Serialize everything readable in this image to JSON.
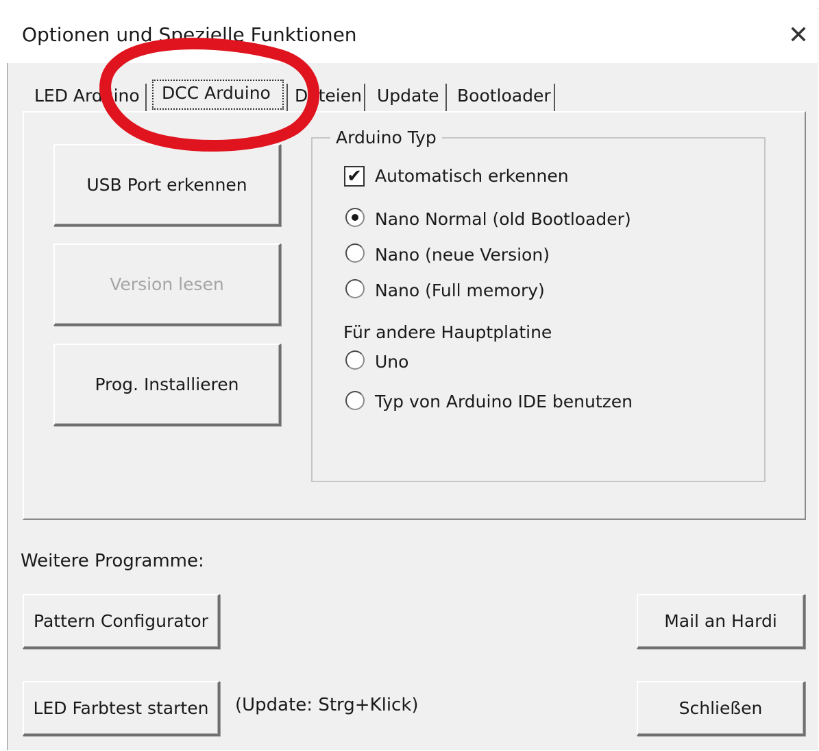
{
  "window": {
    "title": "Optionen und Spezielle Funktionen",
    "close_glyph": "✕"
  },
  "tabs": [
    {
      "label": "LED Arduino"
    },
    {
      "label": "DCC Arduino",
      "selected": true
    },
    {
      "label": "Dateien"
    },
    {
      "label": "Update"
    },
    {
      "label": "Bootloader"
    }
  ],
  "left_buttons": [
    {
      "label": "USB Port erkennen",
      "enabled": true
    },
    {
      "label": "Version lesen",
      "enabled": false
    },
    {
      "label": "Prog. Installieren",
      "enabled": true
    }
  ],
  "arduino_group": {
    "title": "Arduino Typ",
    "auto_detect": {
      "label": "Automatisch erkennen",
      "checked": true
    },
    "options": [
      {
        "label": "Nano Normal (old Bootloader)",
        "selected": true
      },
      {
        "label": "Nano (neue Version)",
        "selected": false
      },
      {
        "label": "Nano (Full memory)",
        "selected": false
      }
    ],
    "other_heading": "Für andere Hauptplatine",
    "other_options": [
      {
        "label": "Uno",
        "selected": false
      },
      {
        "label": "Typ von Arduino IDE benutzen",
        "selected": false
      }
    ]
  },
  "footer": {
    "more_programs_label": "Weitere Programme:",
    "pattern_button": "Pattern Configurator",
    "mail_button": "Mail an Hardi",
    "led_test_button": "LED Farbtest starten",
    "update_hint": "(Update: Strg+Klick)",
    "close_button": "Schließen"
  },
  "annotation": {
    "color": "#e0141e",
    "shape": "ellipse-highlight"
  },
  "colors": {
    "dialog_bg": "#f0f0f0",
    "disabled_text": "#a5a5a5"
  }
}
